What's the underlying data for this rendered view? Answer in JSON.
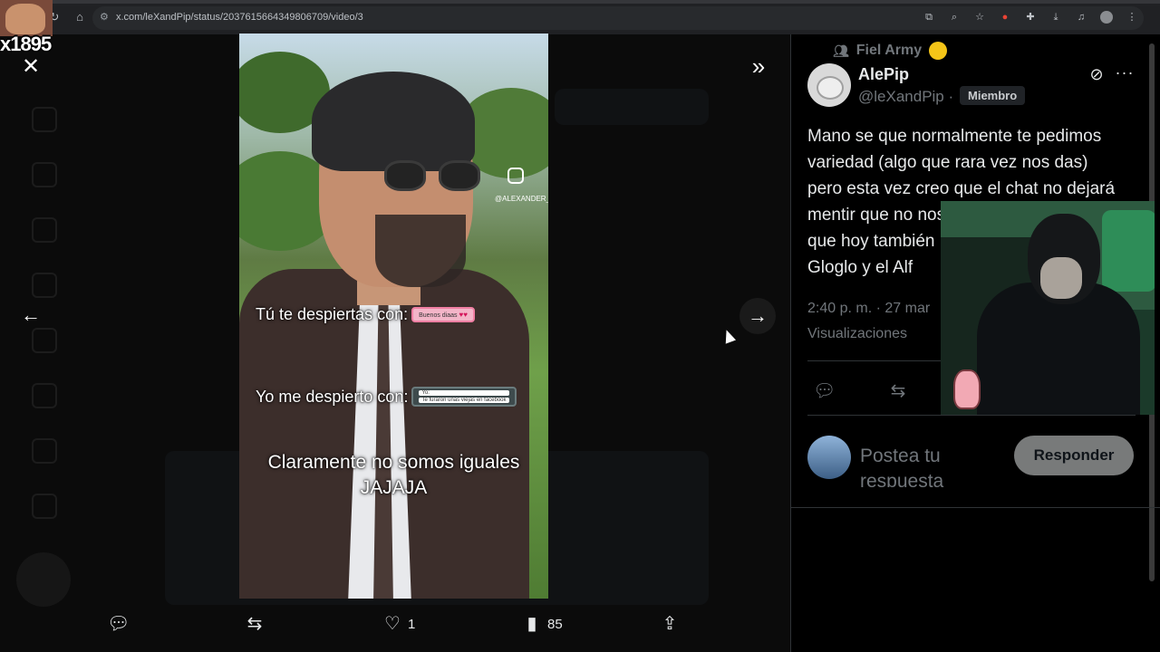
{
  "browser": {
    "url": "x.com/leXandPip/status/2037615664349806709/video/3"
  },
  "streamer_overlay": {
    "name": "x1895"
  },
  "video": {
    "watermark_handle": "@ALEXANDER_B_R",
    "caption_1": "Tú te despiertas con:",
    "bubble_1": "Buenos diaas",
    "caption_2": "Yo me despierto con:",
    "bubble_2a": "Yo:",
    "bubble_2b": "Te furaron unas viejas en facebook",
    "caption_3_line1": "Claramente no somos iguales",
    "caption_3_line2": "JAJAJA"
  },
  "actions": {
    "likes": "1",
    "views": "85"
  },
  "post": {
    "community": "Fiel Army",
    "author_name": "AlePip",
    "author_handle": "@leXandPip ·",
    "badge": "Miembro",
    "text": "Mano se que normalmente te pedimos variedad (algo que rara vez nos das) pero esta vez creo que el chat no dejará mentir que no nos que hoy también Gloglo y el Alf",
    "text_lines": [
      "Mano se que normalmente te pedimos",
      "variedad (algo que rara vez nos das)",
      "pero esta vez creo que el chat no dejará",
      "mentir que no nos",
      "que hoy también",
      "Gloglo y el Alf"
    ],
    "timestamp": "2:40 p. m. · 27 mar",
    "views_label": "Visualizaciones"
  },
  "reply": {
    "placeholder": "Postea tu respuesta",
    "button_label": "Responder"
  },
  "colors": {
    "background": "#000000",
    "muted_text": "#71767b",
    "primary_text": "#e7e9ea",
    "reply_button": "#787a7a"
  },
  "icons": {
    "close": "close-icon",
    "back": "arrow-left-icon",
    "next": "arrow-right-icon",
    "expand": "double-chevron-right-icon",
    "reply": "reply-icon",
    "repost": "repost-icon",
    "like": "heart-icon",
    "views": "bar-chart-icon",
    "share": "share-icon",
    "grok": "grok-icon",
    "more": "more-icon"
  }
}
